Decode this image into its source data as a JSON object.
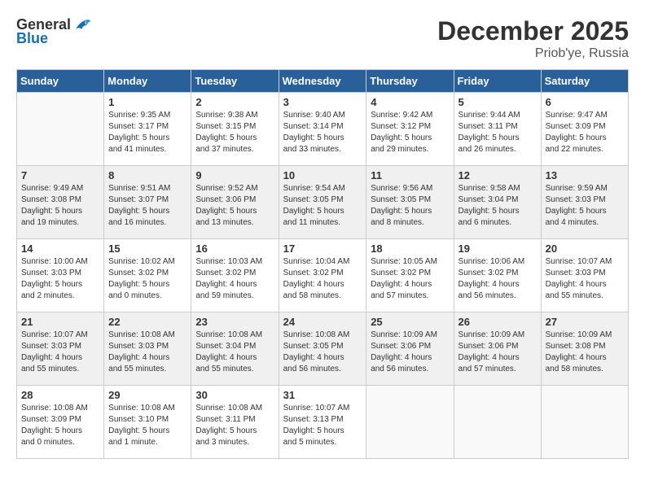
{
  "header": {
    "logo_general": "General",
    "logo_blue": "Blue",
    "month_title": "December 2025",
    "location": "Priob'ye, Russia"
  },
  "calendar": {
    "days_of_week": [
      "Sunday",
      "Monday",
      "Tuesday",
      "Wednesday",
      "Thursday",
      "Friday",
      "Saturday"
    ],
    "weeks": [
      [
        {
          "day": "",
          "info": ""
        },
        {
          "day": "1",
          "info": "Sunrise: 9:35 AM\nSunset: 3:17 PM\nDaylight: 5 hours\nand 41 minutes."
        },
        {
          "day": "2",
          "info": "Sunrise: 9:38 AM\nSunset: 3:15 PM\nDaylight: 5 hours\nand 37 minutes."
        },
        {
          "day": "3",
          "info": "Sunrise: 9:40 AM\nSunset: 3:14 PM\nDaylight: 5 hours\nand 33 minutes."
        },
        {
          "day": "4",
          "info": "Sunrise: 9:42 AM\nSunset: 3:12 PM\nDaylight: 5 hours\nand 29 minutes."
        },
        {
          "day": "5",
          "info": "Sunrise: 9:44 AM\nSunset: 3:11 PM\nDaylight: 5 hours\nand 26 minutes."
        },
        {
          "day": "6",
          "info": "Sunrise: 9:47 AM\nSunset: 3:09 PM\nDaylight: 5 hours\nand 22 minutes."
        }
      ],
      [
        {
          "day": "7",
          "info": "Sunrise: 9:49 AM\nSunset: 3:08 PM\nDaylight: 5 hours\nand 19 minutes."
        },
        {
          "day": "8",
          "info": "Sunrise: 9:51 AM\nSunset: 3:07 PM\nDaylight: 5 hours\nand 16 minutes."
        },
        {
          "day": "9",
          "info": "Sunrise: 9:52 AM\nSunset: 3:06 PM\nDaylight: 5 hours\nand 13 minutes."
        },
        {
          "day": "10",
          "info": "Sunrise: 9:54 AM\nSunset: 3:05 PM\nDaylight: 5 hours\nand 11 minutes."
        },
        {
          "day": "11",
          "info": "Sunrise: 9:56 AM\nSunset: 3:05 PM\nDaylight: 5 hours\nand 8 minutes."
        },
        {
          "day": "12",
          "info": "Sunrise: 9:58 AM\nSunset: 3:04 PM\nDaylight: 5 hours\nand 6 minutes."
        },
        {
          "day": "13",
          "info": "Sunrise: 9:59 AM\nSunset: 3:03 PM\nDaylight: 5 hours\nand 4 minutes."
        }
      ],
      [
        {
          "day": "14",
          "info": "Sunrise: 10:00 AM\nSunset: 3:03 PM\nDaylight: 5 hours\nand 2 minutes."
        },
        {
          "day": "15",
          "info": "Sunrise: 10:02 AM\nSunset: 3:02 PM\nDaylight: 5 hours\nand 0 minutes."
        },
        {
          "day": "16",
          "info": "Sunrise: 10:03 AM\nSunset: 3:02 PM\nDaylight: 4 hours\nand 59 minutes."
        },
        {
          "day": "17",
          "info": "Sunrise: 10:04 AM\nSunset: 3:02 PM\nDaylight: 4 hours\nand 58 minutes."
        },
        {
          "day": "18",
          "info": "Sunrise: 10:05 AM\nSunset: 3:02 PM\nDaylight: 4 hours\nand 57 minutes."
        },
        {
          "day": "19",
          "info": "Sunrise: 10:06 AM\nSunset: 3:02 PM\nDaylight: 4 hours\nand 56 minutes."
        },
        {
          "day": "20",
          "info": "Sunrise: 10:07 AM\nSunset: 3:03 PM\nDaylight: 4 hours\nand 55 minutes."
        }
      ],
      [
        {
          "day": "21",
          "info": "Sunrise: 10:07 AM\nSunset: 3:03 PM\nDaylight: 4 hours\nand 55 minutes."
        },
        {
          "day": "22",
          "info": "Sunrise: 10:08 AM\nSunset: 3:03 PM\nDaylight: 4 hours\nand 55 minutes."
        },
        {
          "day": "23",
          "info": "Sunrise: 10:08 AM\nSunset: 3:04 PM\nDaylight: 4 hours\nand 55 minutes."
        },
        {
          "day": "24",
          "info": "Sunrise: 10:08 AM\nSunset: 3:05 PM\nDaylight: 4 hours\nand 56 minutes."
        },
        {
          "day": "25",
          "info": "Sunrise: 10:09 AM\nSunset: 3:06 PM\nDaylight: 4 hours\nand 56 minutes."
        },
        {
          "day": "26",
          "info": "Sunrise: 10:09 AM\nSunset: 3:06 PM\nDaylight: 4 hours\nand 57 minutes."
        },
        {
          "day": "27",
          "info": "Sunrise: 10:09 AM\nSunset: 3:08 PM\nDaylight: 4 hours\nand 58 minutes."
        }
      ],
      [
        {
          "day": "28",
          "info": "Sunrise: 10:08 AM\nSunset: 3:09 PM\nDaylight: 5 hours\nand 0 minutes."
        },
        {
          "day": "29",
          "info": "Sunrise: 10:08 AM\nSunset: 3:10 PM\nDaylight: 5 hours\nand 1 minute."
        },
        {
          "day": "30",
          "info": "Sunrise: 10:08 AM\nSunset: 3:11 PM\nDaylight: 5 hours\nand 3 minutes."
        },
        {
          "day": "31",
          "info": "Sunrise: 10:07 AM\nSunset: 3:13 PM\nDaylight: 5 hours\nand 5 minutes."
        },
        {
          "day": "",
          "info": ""
        },
        {
          "day": "",
          "info": ""
        },
        {
          "day": "",
          "info": ""
        }
      ]
    ]
  }
}
